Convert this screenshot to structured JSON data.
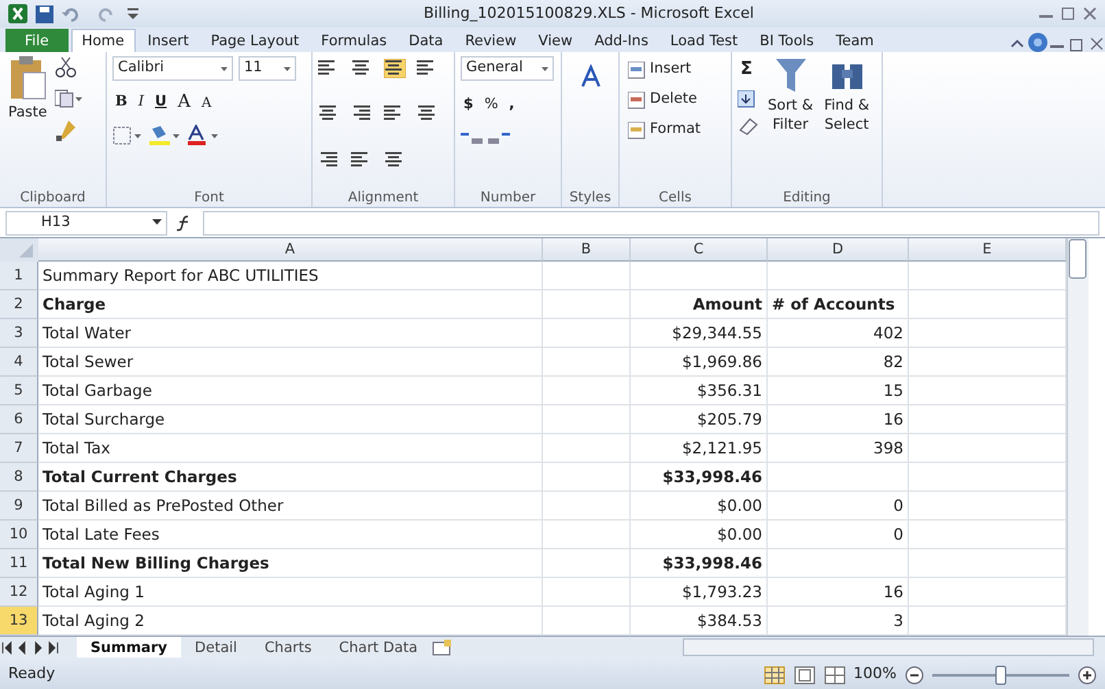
{
  "window": {
    "title": "Billing_102015100829.XLS  -  Microsoft Excel"
  },
  "tabs": [
    {
      "label": "File",
      "selected": false,
      "kind": "file"
    },
    {
      "label": "Home",
      "selected": true,
      "kind": "tab"
    },
    {
      "label": "Insert",
      "selected": false,
      "kind": "tab"
    },
    {
      "label": "Page Layout",
      "selected": false,
      "kind": "tab"
    },
    {
      "label": "Formulas",
      "selected": false,
      "kind": "tab"
    },
    {
      "label": "Data",
      "selected": false,
      "kind": "tab"
    },
    {
      "label": "Review",
      "selected": false,
      "kind": "tab"
    },
    {
      "label": "View",
      "selected": false,
      "kind": "tab"
    },
    {
      "label": "Add-Ins",
      "selected": false,
      "kind": "tab"
    },
    {
      "label": "Load Test",
      "selected": false,
      "kind": "tab"
    },
    {
      "label": "BI Tools",
      "selected": false,
      "kind": "tab"
    },
    {
      "label": "Team",
      "selected": false,
      "kind": "tab"
    }
  ],
  "ribbon": {
    "clipboard": {
      "label": "Clipboard",
      "paste": "Paste"
    },
    "font": {
      "label": "Font",
      "name": "Calibri",
      "size": "11",
      "bold": "B",
      "italic": "I",
      "underline": "U",
      "grow": "A",
      "shrink": "A"
    },
    "alignment": {
      "label": "Alignment"
    },
    "number": {
      "label": "Number",
      "format": "General",
      "currency": "$",
      "percent": "%",
      "comma": ","
    },
    "styles": {
      "label": "Styles"
    },
    "cells": {
      "label": "Cells",
      "items": [
        "Insert",
        "Delete",
        "Format"
      ]
    },
    "editing": {
      "label": "Editing",
      "sum": "Σ",
      "sort": "Sort &",
      "sort2": "Filter",
      "find": "Find &",
      "find2": "Select"
    }
  },
  "name_box": "H13",
  "columns": [
    "A",
    "B",
    "C",
    "D",
    "E"
  ],
  "rows": [
    {
      "num": "1",
      "selected": false,
      "bold": false,
      "cells": [
        "Summary Report for ABC UTILITIES",
        "",
        "",
        ""
      ]
    },
    {
      "num": "2",
      "selected": false,
      "bold": true,
      "cells": [
        "Charge",
        "",
        "Amount",
        "# of Accounts"
      ]
    },
    {
      "num": "3",
      "selected": false,
      "bold": false,
      "cells": [
        "Total Water",
        "",
        "$29,344.55",
        "402"
      ]
    },
    {
      "num": "4",
      "selected": false,
      "bold": false,
      "cells": [
        "Total Sewer",
        "",
        "$1,969.86",
        "82"
      ]
    },
    {
      "num": "5",
      "selected": false,
      "bold": false,
      "cells": [
        "Total Garbage",
        "",
        "$356.31",
        "15"
      ]
    },
    {
      "num": "6",
      "selected": false,
      "bold": false,
      "cells": [
        "Total Surcharge",
        "",
        "$205.79",
        "16"
      ]
    },
    {
      "num": "7",
      "selected": false,
      "bold": false,
      "cells": [
        "Total Tax",
        "",
        "$2,121.95",
        "398"
      ]
    },
    {
      "num": "8",
      "selected": false,
      "bold": true,
      "cells": [
        "Total Current Charges",
        "",
        "$33,998.46",
        ""
      ]
    },
    {
      "num": "9",
      "selected": false,
      "bold": false,
      "cells": [
        "Total Billed as PrePosted Other",
        "",
        "$0.00",
        "0"
      ]
    },
    {
      "num": "10",
      "selected": false,
      "bold": false,
      "cells": [
        "Total Late Fees",
        "",
        "$0.00",
        "0"
      ]
    },
    {
      "num": "11",
      "selected": false,
      "bold": true,
      "cells": [
        "Total New Billing Charges",
        "",
        "$33,998.46",
        ""
      ]
    },
    {
      "num": "12",
      "selected": false,
      "bold": false,
      "cells": [
        "Total Aging 1",
        "",
        "$1,793.23",
        "16"
      ]
    },
    {
      "num": "13",
      "selected": true,
      "bold": false,
      "cells": [
        "Total Aging 2",
        "",
        "$384.53",
        "3"
      ]
    }
  ],
  "sheet_tabs": [
    {
      "label": "Summary",
      "selected": true
    },
    {
      "label": "Detail",
      "selected": false
    },
    {
      "label": "Charts",
      "selected": false
    },
    {
      "label": "Chart Data",
      "selected": false
    }
  ],
  "status_bar": {
    "text": "Ready",
    "zoom": "100%",
    "zoom_slider": {
      "level": 0.5
    }
  }
}
